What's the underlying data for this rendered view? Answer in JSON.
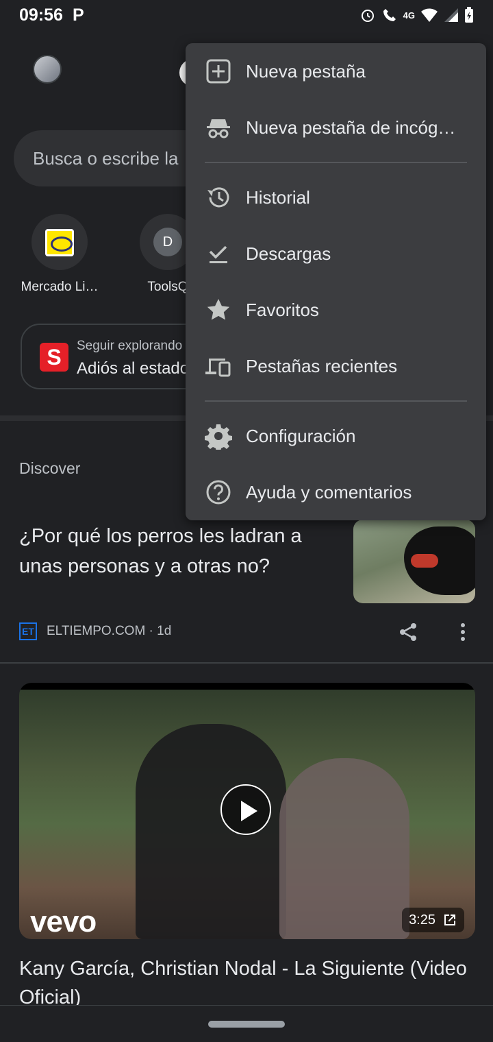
{
  "status_bar": {
    "time": "09:56",
    "p_badge": "P",
    "network": "4G"
  },
  "ntp": {
    "search_placeholder": "Busca o escribe la",
    "shortcuts": [
      {
        "label": "Mercado Li…",
        "icon": "mercado-libre-icon"
      },
      {
        "label": "ToolsQ",
        "badge": "D"
      }
    ],
    "explore": {
      "subtitle": "Seguir explorando",
      "title": "Adiós al estado"
    }
  },
  "discover": {
    "label": "Discover",
    "article": {
      "title": "¿Por qué los perros les ladran a unas personas y a otras no?",
      "source_logo": "ET",
      "source": "ELTIEMPO.COM · 1d"
    },
    "video": {
      "brand": "vevo",
      "duration": "3:25",
      "title": "Kany García, Christian Nodal - La Siguiente (Video Oficial)"
    }
  },
  "menu": {
    "items": [
      {
        "label": "Nueva pestaña",
        "icon": "new-tab-icon"
      },
      {
        "label": "Nueva pestaña de incóg…",
        "icon": "incognito-icon"
      },
      {
        "label": "Historial",
        "icon": "history-icon"
      },
      {
        "label": "Descargas",
        "icon": "download-icon"
      },
      {
        "label": "Favoritos",
        "icon": "star-icon"
      },
      {
        "label": "Pestañas recientes",
        "icon": "devices-icon"
      },
      {
        "label": "Configuración",
        "icon": "gear-icon"
      },
      {
        "label": "Ayuda y comentarios",
        "icon": "help-icon"
      }
    ]
  }
}
